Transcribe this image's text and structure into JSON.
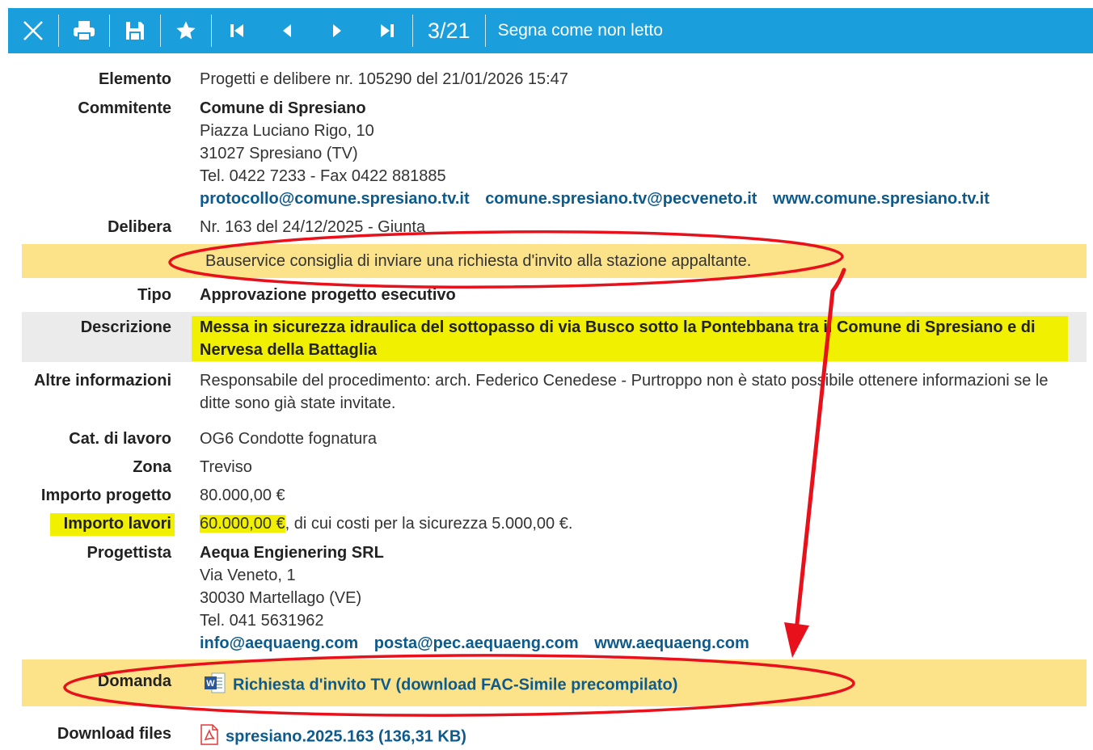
{
  "toolbar": {
    "counter": "3/21",
    "mark_unread": "Segna come non letto",
    "icons": [
      "close-icon",
      "print-icon",
      "save-icon",
      "star-icon",
      "first-icon",
      "prev-icon",
      "next-icon",
      "last-icon"
    ]
  },
  "colors": {
    "toolbar_bg": "#1a9fdc",
    "band_bg": "#fce38a",
    "highlight": "#f0f000",
    "row_gray": "#ebebeb",
    "link": "#0d5a8c",
    "annotation": "#e8101a"
  },
  "labels": {
    "elemento": "Elemento",
    "committente": "Commitente",
    "delibera": "Delibera",
    "tipo": "Tipo",
    "descrizione": "Descrizione",
    "altre_info": "Altre informazioni",
    "cat_lavoro": "Cat. di lavoro",
    "zona": "Zona",
    "importo_progetto": "Importo progetto",
    "importo_lavori": "Importo lavori",
    "progettista": "Progettista",
    "domanda": "Domanda",
    "download_files": "Download files"
  },
  "values": {
    "elemento": "Progetti e delibere nr. 105290 del 21/01/2026 15:47",
    "committente": {
      "name": "Comune di Spresiano",
      "address": "Piazza Luciano Rigo, 10",
      "city": "31027 Spresiano (TV)",
      "phone": "Tel. 0422 7233 - Fax 0422 881885",
      "email": "protocollo@comune.spresiano.tv.it",
      "pec": "comune.spresiano.tv@pecveneto.it",
      "web": "www.comune.spresiano.tv.it"
    },
    "delibera": "Nr. 163 del 24/12/2025 - Giunta",
    "advice": "Bauservice consiglia di inviare una richiesta d'invito alla stazione appaltante.",
    "tipo": "Approvazione progetto esecutivo",
    "descrizione_1": "Messa in sicurezza idraulica del sottopasso di via Busco sotto la Pontebbana tra il Comune di Spresiano e di",
    "descrizione_2": "Nervesa della Battaglia",
    "altre_info_1": "Responsabile del procedimento: arch. Federico Cenedese - Purtroppo non è stato possibile ottenere informazioni se le",
    "altre_info_2": "ditte sono già state invitate.",
    "cat_lavoro": "OG6 Condotte fognatura",
    "zona": "Treviso",
    "importo_progetto": "80.000,00 €",
    "importo_lavori_amount": "60.000,00 €",
    "importo_lavori_rest": ", di cui costi per la sicurezza 5.000,00 €.",
    "progettista": {
      "name": "Aequa Engienering SRL",
      "address": "Via Veneto, 1",
      "city": "30030 Martellago (VE)",
      "phone": "Tel. 041 5631962",
      "email": "info@aequaeng.com",
      "pec": "posta@pec.aequaeng.com",
      "web": "www.aequaeng.com"
    },
    "domanda_link": "Richiesta d'invito TV (download FAC-Simile precompilato)",
    "download_file": "spresiano.2025.163 (136,31 KB)"
  }
}
